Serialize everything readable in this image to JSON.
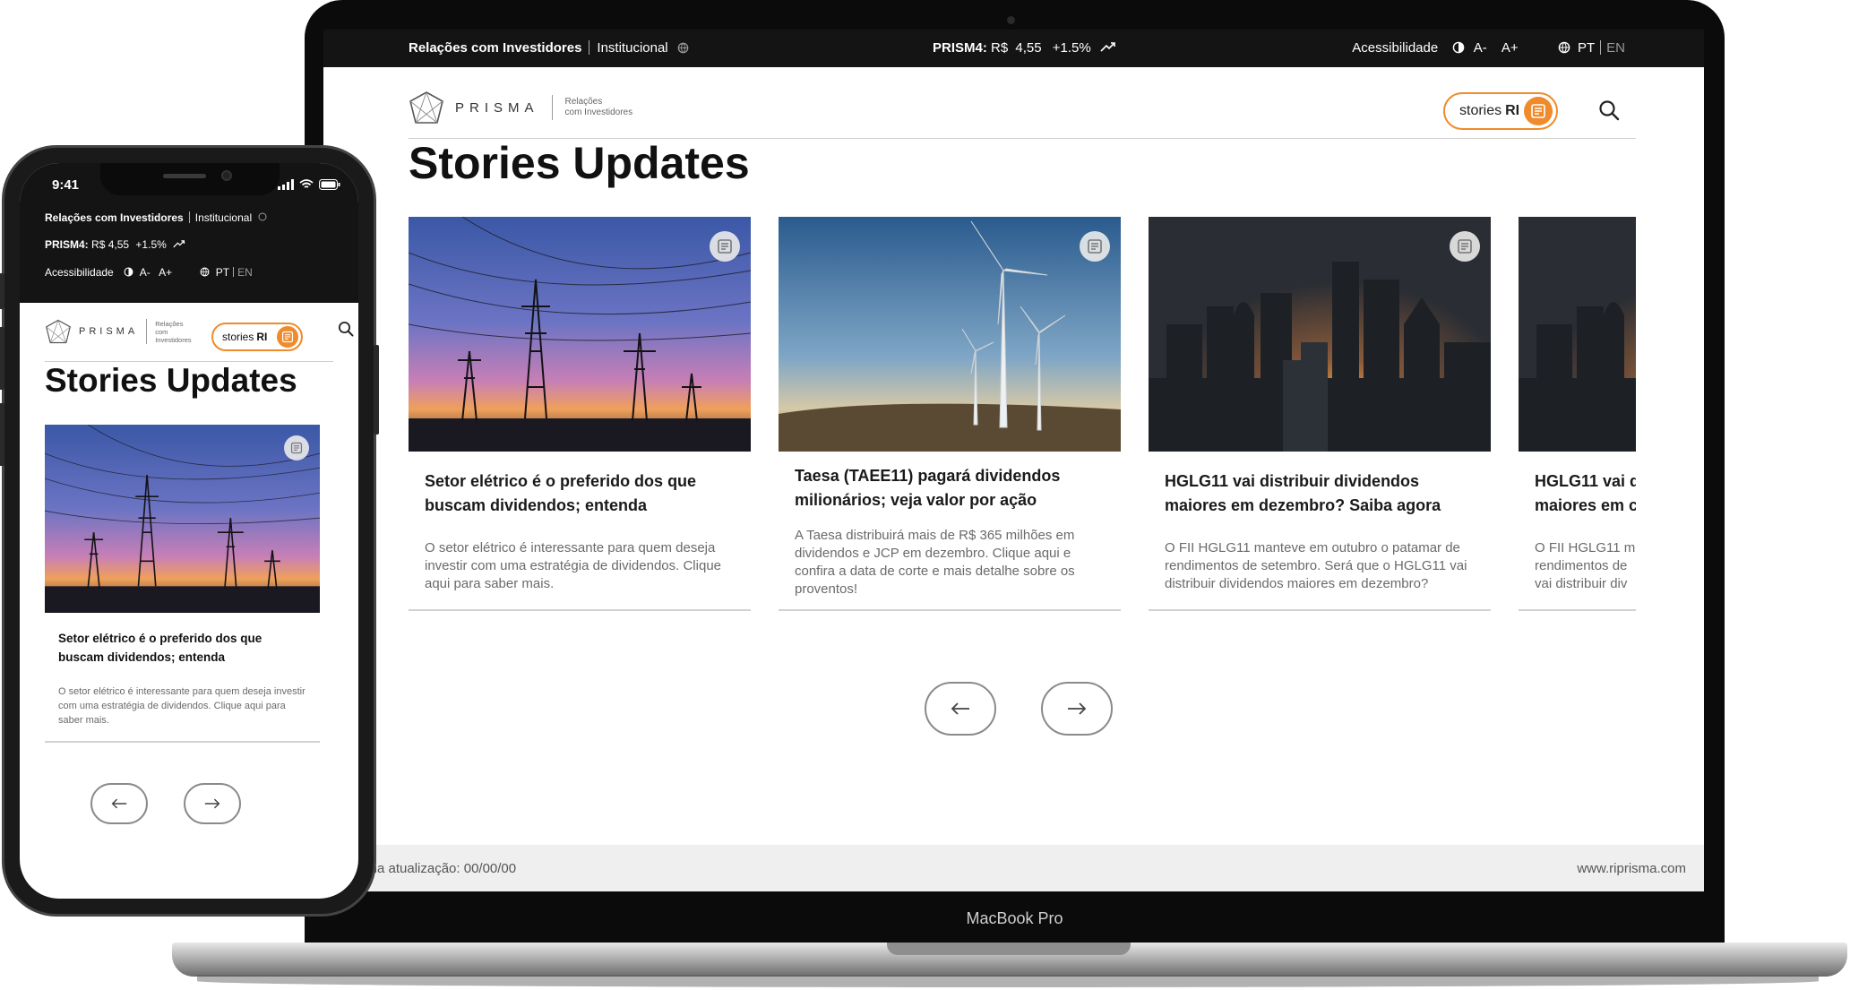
{
  "device": {
    "laptop_model": "MacBook Pro",
    "phone_time": "9:41"
  },
  "topbar": {
    "ir_label": "Relações com Investidores",
    "institutional_label": "Institucional",
    "ticker_label": "PRISM4:",
    "currency": "R$",
    "price": "4,55",
    "change": "+1.5%",
    "accessibility_label": "Acessibilidade",
    "font_decrease": "A-",
    "font_increase": "A+",
    "lang_pt": "PT",
    "lang_en": "EN"
  },
  "header": {
    "logo_word": "PRISMA",
    "logo_sub_line1": "Relações",
    "logo_sub_line2": "com Investidores",
    "stories_label": "stories",
    "stories_bold": "RI"
  },
  "mobile_header": {
    "logo_sub_line1": "Relações",
    "logo_sub_line2": "com",
    "logo_sub_line3": "Investidores"
  },
  "page": {
    "title": "Stories Updates"
  },
  "cards": [
    {
      "title": "Setor elétrico é o preferido dos que buscam dividendos; entenda",
      "description": "O setor elétrico é interessante para quem deseja investir com uma estratégia de dividendos. Clique aqui para saber mais.",
      "image": "power-lines-sunset"
    },
    {
      "title": "Taesa (TAEE11) pagará dividendos milionários; veja valor por ação",
      "description": "A Taesa distribuirá mais de R$ 365 milhões em dividendos e JCP em dezembro. Clique aqui e confira a data de corte e mais detalhe sobre os proventos!",
      "image": "wind-turbines"
    },
    {
      "title": "HGLG11 vai distribuir dividendos maiores em dezembro? Saiba agora",
      "description": "O FII HGLG11 manteve em outubro o patamar de rendimentos de setembro. Será que o HGLG11 vai distribuir dividendos maiores em dezembro?",
      "image": "city-skyline-sunset"
    },
    {
      "title": "HGLG11 vai d",
      "title_line2": "maiores em c",
      "description_line1": "O FII HGLG11 m",
      "description_line2": "rendimentos de",
      "description_line3": "vai distribuir div",
      "image": "city-skyline-sunset"
    }
  ],
  "footer": {
    "last_update": "tima atualização: 00/00/00",
    "site": "www.riprisma.com"
  },
  "icons": {
    "prev": "arrow-left-icon",
    "next": "arrow-right-icon",
    "search": "search-icon",
    "story": "story-document-icon",
    "contrast": "contrast-icon",
    "globe": "globe-icon",
    "trend": "trend-up-icon"
  },
  "colors": {
    "accent": "#ef8b2c",
    "topbar_bg": "#141414",
    "footer_bg": "#efefef"
  }
}
